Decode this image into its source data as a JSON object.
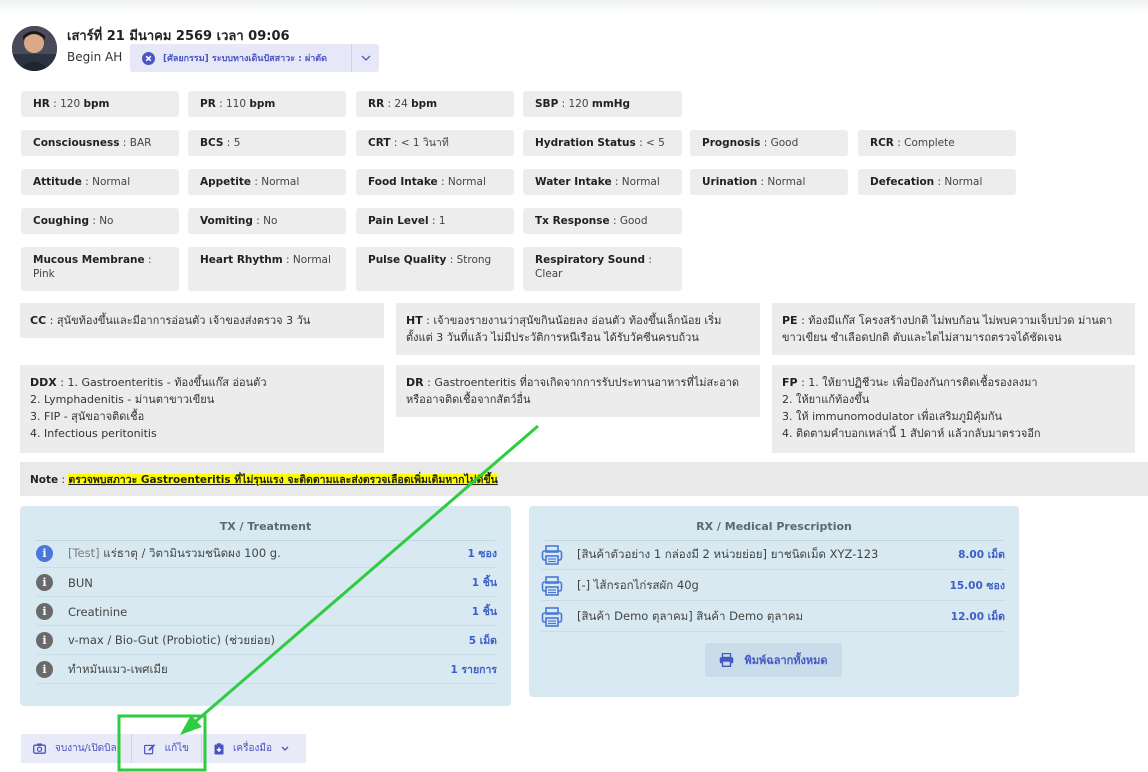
{
  "header": {
    "datetime": "เสาร์ที่ 21 มีนาคม 2569 เวลา 09:06",
    "user_name": "Begin AH",
    "case_label": "[ศัลยกรรม] ระบบทางเดินปัสสาวะ : ผ่าตัด"
  },
  "vitals": [
    {
      "label": "HR",
      "value": "120",
      "unit": "bpm"
    },
    {
      "label": "PR",
      "value": "110",
      "unit": "bpm"
    },
    {
      "label": "RR",
      "value": "24",
      "unit": "bpm"
    },
    {
      "label": "SBP",
      "value": "120",
      "unit": "mmHg"
    }
  ],
  "exam": [
    {
      "label": "Consciousness",
      "value": "BAR"
    },
    {
      "label": "BCS",
      "value": "5"
    },
    {
      "label": "CRT",
      "value": "< 1 วินาที"
    },
    {
      "label": "Hydration Status",
      "value": "< 5"
    },
    {
      "label": "Prognosis",
      "value": "Good"
    },
    {
      "label": "RCR",
      "value": "Complete"
    },
    {
      "label": "Attitude",
      "value": "Normal"
    },
    {
      "label": "Appetite",
      "value": "Normal"
    },
    {
      "label": "Food Intake",
      "value": "Normal"
    },
    {
      "label": "Water Intake",
      "value": "Normal"
    },
    {
      "label": "Urination",
      "value": "Normal"
    },
    {
      "label": "Defecation",
      "value": "Normal"
    },
    {
      "label": "Coughing",
      "value": "No"
    },
    {
      "label": "Vomiting",
      "value": "No"
    },
    {
      "label": "Pain Level",
      "value": "1"
    },
    {
      "label": "Tx Response",
      "value": "Good"
    },
    {
      "label": "Mucous Membrane",
      "value": "Pink"
    },
    {
      "label": "Heart Rhythm",
      "value": "Normal"
    },
    {
      "label": "Pulse Quality",
      "value": "Strong"
    },
    {
      "label": "Respiratory Sound",
      "value": "Clear"
    }
  ],
  "sections": {
    "cc": {
      "label": "CC",
      "lines": [
        "สุนัขท้องขึ้นและมีอาการอ่อนตัว เจ้าของส่งตรวจ 3 วัน"
      ]
    },
    "ht": {
      "label": "HT",
      "lines": [
        "เจ้าของรายงานว่าสุนัขกินน้อยลง อ่อนตัว ท้องขึ้นเล็กน้อย เริ่ม",
        "ตั้งแต่ 3 วันที่แล้ว ไม่มีประวัติการหนีเรือน ได้รับวัคซีนครบถ้วน"
      ]
    },
    "pe": {
      "label": "PE",
      "lines": [
        "ท้องมีแก๊ส โครงสร้างปกติ ไม่พบก้อน ไม่พบความเจ็บปวด ม่านตา",
        "ขาวเขียน ชำเลือดปกติ ตับและไตไม่สามารถตรวจได้ชัดเจน"
      ]
    },
    "ddx": {
      "label": "DDX",
      "lines": [
        "1. Gastroenteritis - ท้องขึ้นแก๊ส อ่อนตัว",
        "2. Lymphadenitis - ม่านตาขาวเขียน",
        "3. FIP - สุนัขอาจติดเชื้อ",
        "4. Infectious peritonitis"
      ]
    },
    "dr": {
      "label": "DR",
      "lines": [
        "Gastroenteritis ที่อาจเกิดจากการรับประทานอาหารที่ไม่สะอาด",
        "หรืออาจติดเชื้อจากสัตว์อื่น"
      ]
    },
    "fp": {
      "label": "FP",
      "lines": [
        "1. ให้ยาปฏิชีวนะ เพื่อป้องกันการติดเชื้อรองลงมา",
        "2. ให้ยาแก้ท้องขึ้น",
        "3. ให้ immunomodulator เพื่อเสริมภูมิคุ้มกัน",
        "4. ติดตามคำบอกเหล่านี้ 1 สัปดาห์ แล้วกลับมาตรวจอีก"
      ]
    }
  },
  "note": {
    "label": "Note",
    "text": "ตรวจพบสภาวะ Gastroenteritis ที่ไม่รุนแรง จะติดตามและส่งตรวจเลือดเพิ่มเติมหากไม่ดีขึ้น"
  },
  "tx": {
    "title": "TX / Treatment",
    "items": [
      {
        "icon": "info-icon",
        "tag": "[Test]",
        "name": "แร่ธาตุ / วิตามินรวมชนิดผง 100 g.",
        "qty": "1 ซอง"
      },
      {
        "icon": "info-icon",
        "tag": "",
        "name": "BUN",
        "qty": "1 ชิ้น"
      },
      {
        "icon": "info-icon",
        "tag": "",
        "name": "Creatinine",
        "qty": "1 ชิ้น"
      },
      {
        "icon": "info-icon",
        "tag": "",
        "name": "v-max / Bio-Gut (Probiotic) (ช่วยย่อย)",
        "qty": "5 เม็ด"
      },
      {
        "icon": "info-icon",
        "tag": "",
        "name": "ทำหมันแมว-เพศเมีย",
        "qty": "1 รายการ"
      }
    ]
  },
  "rx": {
    "title": "RX / Medical Prescription",
    "items": [
      {
        "icon": "printer-icon",
        "name": "[สินค้าตัวอย่าง 1 กล่องมี 2 หน่วยย่อย] ยาชนิดเม็ด XYZ-123",
        "qty": "8.00 เม็ด"
      },
      {
        "icon": "printer-icon",
        "name": "[-] ไส้กรอกไก่รสผัก 40g",
        "qty": "15.00 ซอง"
      },
      {
        "icon": "printer-icon",
        "name": "[สินค้า Demo ตุลาคม] สินค้า Demo ตุลาคม",
        "qty": "12.00 เม็ด"
      }
    ],
    "print_all_label": "พิมพ์ฉลากทั้งหมด"
  },
  "toolbar": {
    "appointment_label": "จบงาน/เปิดบิล",
    "edit_label": "แก้ไข",
    "tools_label": "เครื่องมือ"
  },
  "colors": {
    "accent": "#4b55c6",
    "panel_bg": "#d8e9f1",
    "annotation_green": "#2ecc40",
    "highlight": "#ffff00"
  }
}
